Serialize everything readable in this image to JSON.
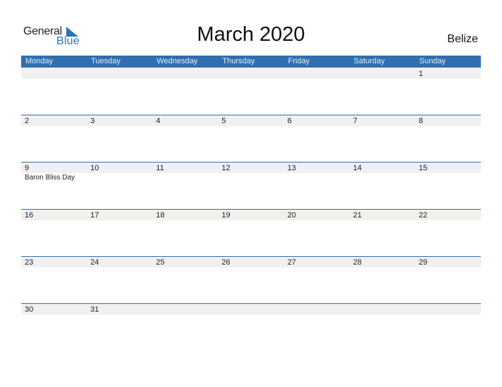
{
  "logo": {
    "line1": "General",
    "line2": "Blue",
    "icon": "blue-triangle-icon"
  },
  "title": "March 2020",
  "country": "Belize",
  "colors": {
    "accent": "#2f6fb0",
    "band": "#f0f0f0"
  },
  "weekdays": [
    "Monday",
    "Tuesday",
    "Wednesday",
    "Thursday",
    "Friday",
    "Saturday",
    "Sunday"
  ],
  "weeks": [
    [
      {
        "day": ""
      },
      {
        "day": ""
      },
      {
        "day": ""
      },
      {
        "day": ""
      },
      {
        "day": ""
      },
      {
        "day": ""
      },
      {
        "day": "1"
      }
    ],
    [
      {
        "day": "2"
      },
      {
        "day": "3"
      },
      {
        "day": "4"
      },
      {
        "day": "5"
      },
      {
        "day": "6"
      },
      {
        "day": "7"
      },
      {
        "day": "8"
      }
    ],
    [
      {
        "day": "9",
        "event": "Baron Bliss Day"
      },
      {
        "day": "10"
      },
      {
        "day": "11"
      },
      {
        "day": "12"
      },
      {
        "day": "13"
      },
      {
        "day": "14"
      },
      {
        "day": "15"
      }
    ],
    [
      {
        "day": "16"
      },
      {
        "day": "17"
      },
      {
        "day": "18"
      },
      {
        "day": "19"
      },
      {
        "day": "20"
      },
      {
        "day": "21"
      },
      {
        "day": "22"
      }
    ],
    [
      {
        "day": "23"
      },
      {
        "day": "24"
      },
      {
        "day": "25"
      },
      {
        "day": "26"
      },
      {
        "day": "27"
      },
      {
        "day": "28"
      },
      {
        "day": "29"
      }
    ],
    [
      {
        "day": "30"
      },
      {
        "day": "31"
      },
      {
        "day": ""
      },
      {
        "day": ""
      },
      {
        "day": ""
      },
      {
        "day": ""
      },
      {
        "day": ""
      }
    ]
  ]
}
